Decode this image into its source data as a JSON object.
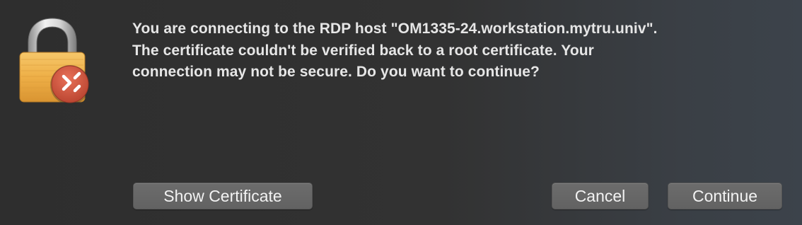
{
  "dialog": {
    "icon": "rdp-lock-icon",
    "message_lines": [
      "You are connecting to the RDP host \"OM1335-24.workstation.mytru.univ\".",
      "The certificate couldn't be verified back to a root certificate. Your",
      "connection may not be secure. Do you want to continue?"
    ],
    "buttons": {
      "show_certificate": "Show Certificate",
      "cancel": "Cancel",
      "continue": "Continue"
    }
  },
  "colors": {
    "background": "#2e2e2e",
    "text": "#e6e6e6",
    "button": "#666666",
    "lock_body": "#f0b24a",
    "badge": "#d2563f"
  }
}
